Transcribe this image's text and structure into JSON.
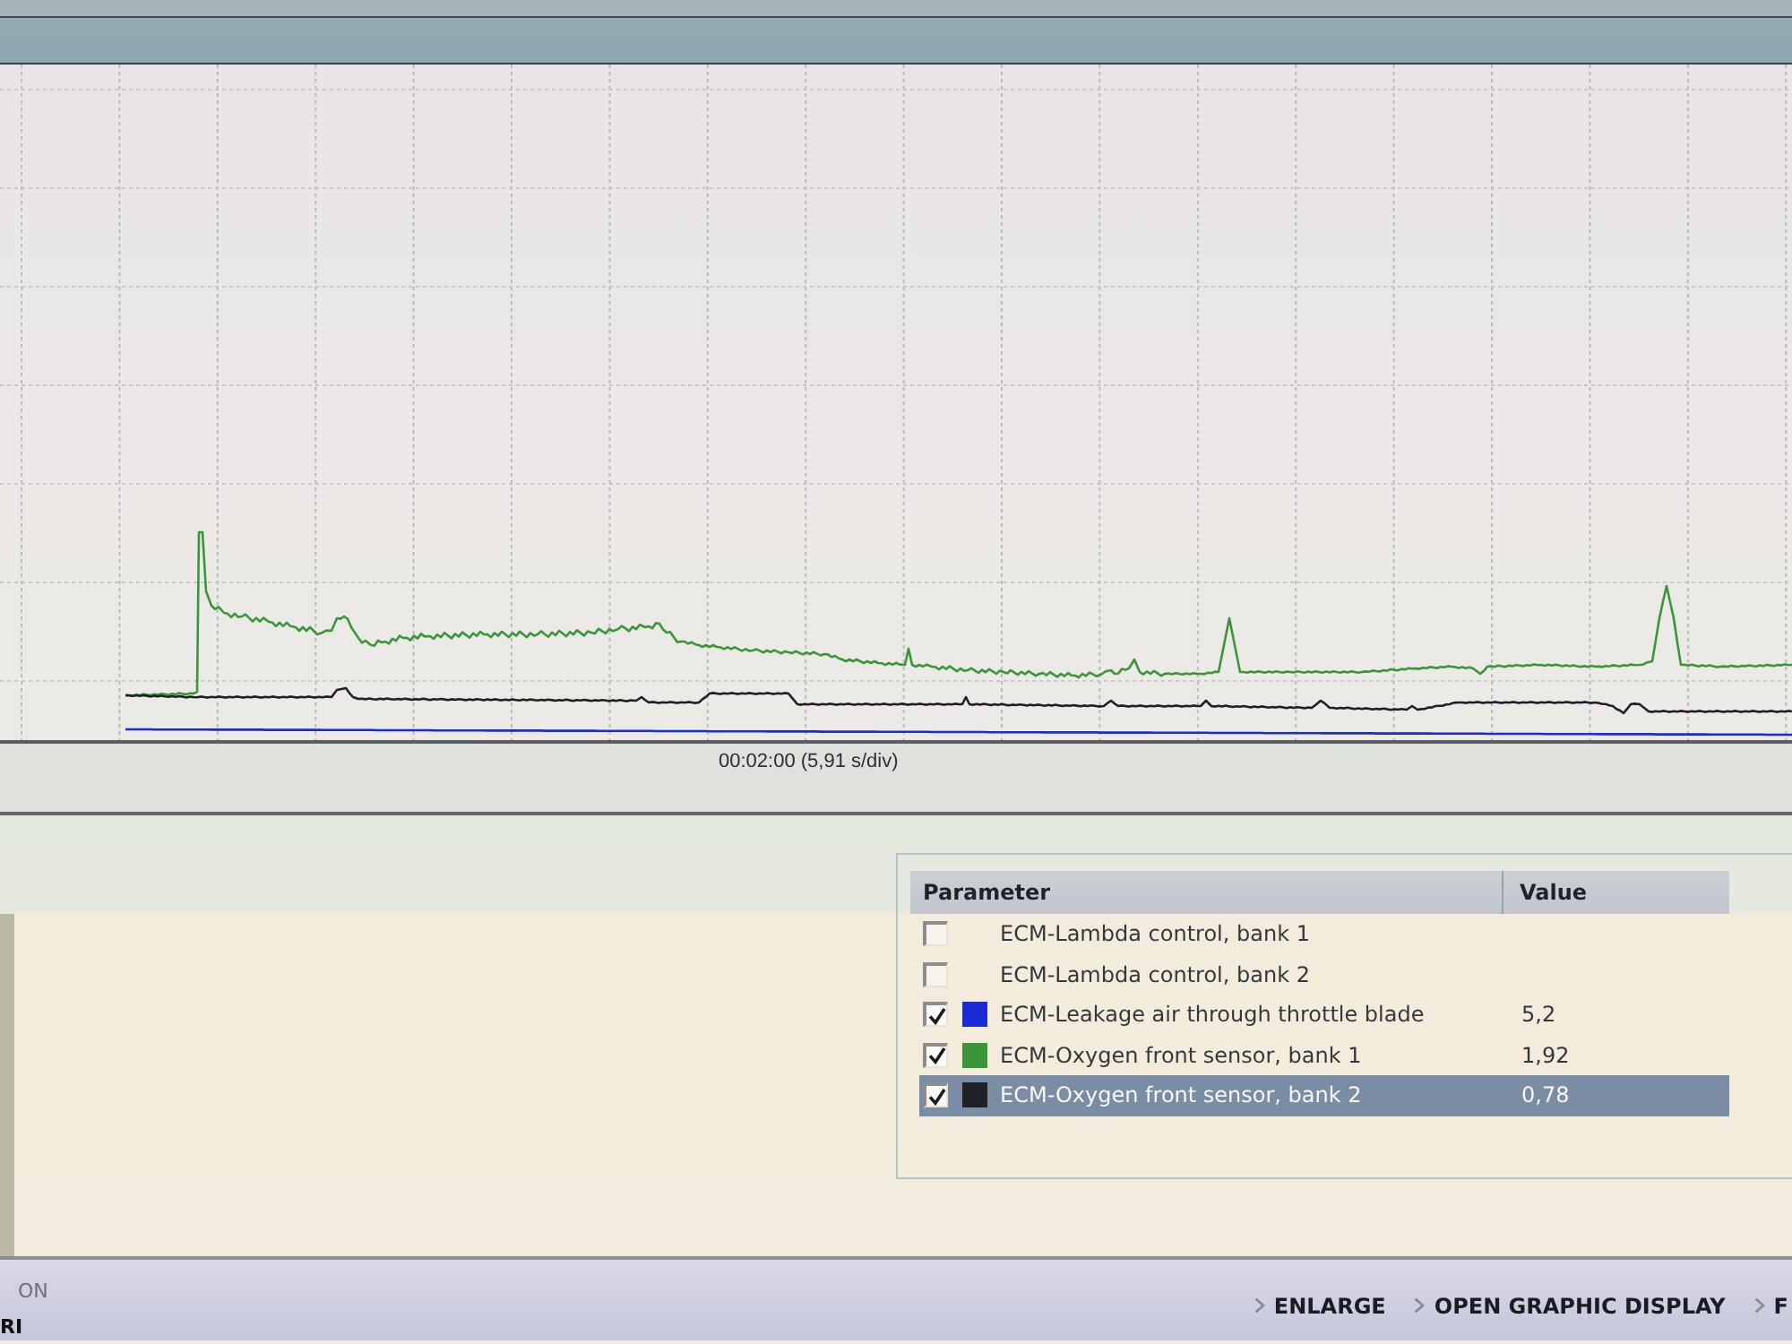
{
  "graph": {
    "time_scale": "00:02:00 (5,91 s/div)"
  },
  "parameter_table": {
    "columns": [
      "Parameter",
      "Value"
    ],
    "rows": [
      {
        "name": "ECM-Lambda control, bank 1",
        "checked": false,
        "selected": false
      },
      {
        "name": "ECM-Lambda control, bank 2",
        "checked": false,
        "selected": false
      },
      {
        "name": "ECM-Leakage air through throttle blade",
        "value": "5,2",
        "checked": true,
        "color": "#1a2bd6",
        "selected": false
      },
      {
        "name": "ECM-Oxygen front sensor, bank 1",
        "value": "1,92",
        "checked": true,
        "color": "#3b963a",
        "selected": false
      },
      {
        "name": "ECM-Oxygen front sensor, bank 2",
        "value": "0,78",
        "checked": true,
        "color": "#1e2126",
        "selected": true
      }
    ]
  },
  "status_bar": {
    "texts": [
      "ON",
      "RI"
    ],
    "buttons": [
      "ENLARGE",
      "OPEN GRAPHIC DISPLAY",
      "F"
    ]
  }
}
